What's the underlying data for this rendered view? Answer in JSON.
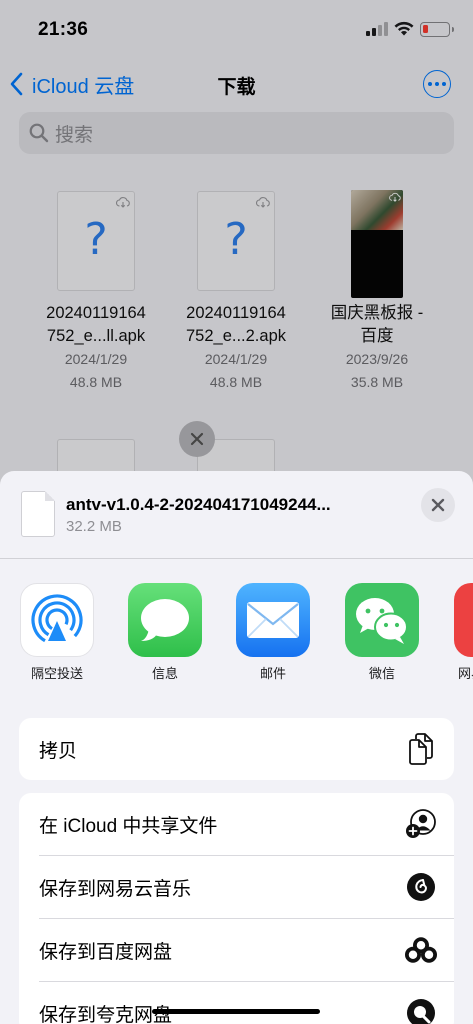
{
  "status": {
    "time": "21:36"
  },
  "nav": {
    "back_label": "iCloud 云盘",
    "title": "下载"
  },
  "search": {
    "placeholder": "搜索"
  },
  "files": [
    {
      "name_line1": "20240119164",
      "name_line2": "752_e...ll.apk",
      "date": "2024/1/29",
      "size": "48.8 MB",
      "icon": "unknown-file-icon"
    },
    {
      "name_line1": "20240119164",
      "name_line2": "752_e...2.apk",
      "date": "2024/1/29",
      "size": "48.8 MB",
      "icon": "unknown-file-icon"
    },
    {
      "name_line1": "国庆黑板报 -",
      "name_line2": "百度",
      "date": "2023/9/26",
      "size": "35.8 MB",
      "icon": "image-thumbnail"
    }
  ],
  "share_sheet": {
    "file_name": "antv-v1.0.4-2-202404171049244...",
    "file_size": "32.2 MB",
    "apps": [
      {
        "label": "隔空投送",
        "icon": "airdrop-icon"
      },
      {
        "label": "信息",
        "icon": "messages-icon"
      },
      {
        "label": "邮件",
        "icon": "mail-icon"
      },
      {
        "label": "微信",
        "icon": "wechat-icon"
      },
      {
        "label": "网易",
        "icon": "netease-music-icon"
      }
    ],
    "copy_label": "拷贝",
    "actions": [
      {
        "label": "在 iCloud 中共享文件",
        "icon": "person-add-icon"
      },
      {
        "label": "保存到网易云音乐",
        "icon": "netease-music-icon"
      },
      {
        "label": "保存到百度网盘",
        "icon": "baidu-netdisk-icon"
      },
      {
        "label": "保存到夸克网盘",
        "icon": "quark-icon"
      }
    ]
  },
  "colors": {
    "accent": "#007aff",
    "battery_low": "#ff3b30",
    "messages_green": "#34c759",
    "wechat_green": "#3fc363"
  }
}
